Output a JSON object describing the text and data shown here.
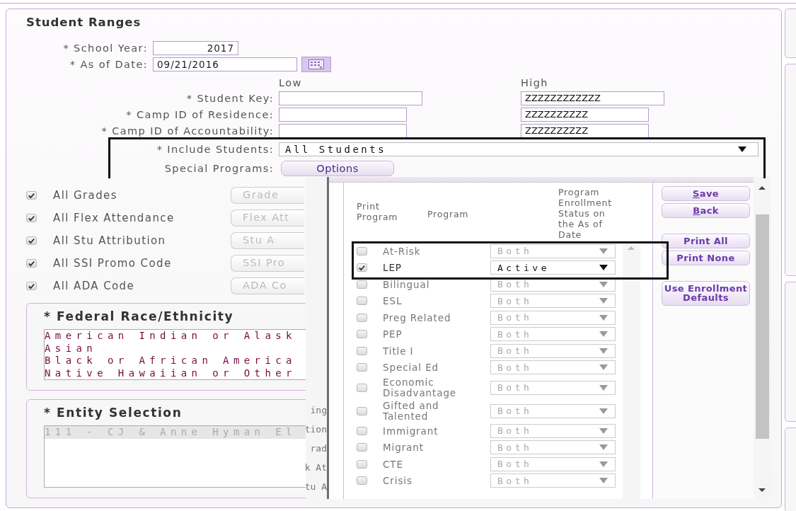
{
  "form": {
    "title": "Student Ranges",
    "school_year": {
      "label": "* School Year:",
      "value": "2017"
    },
    "as_of_date": {
      "label": "* As of Date:",
      "value": "09/21/2016"
    },
    "range_headers": {
      "low": "Low",
      "high": "High"
    },
    "ranges": [
      {
        "label": "* Student Key:",
        "high": "ZZZZZZZZZZZZ"
      },
      {
        "label": "* Camp ID of Residence:",
        "high": "ZZZZZZZZZZ"
      },
      {
        "label": "* Camp ID of Accountability:",
        "high": "ZZZZZZZZZZ"
      }
    ],
    "include_students": {
      "label": "* Include Students:",
      "value": "All Students"
    },
    "special_programs": {
      "label": "Special Programs:",
      "button": "Options"
    },
    "filters": [
      {
        "label": "All Grades",
        "checked": true,
        "button": "Grade",
        "disabled": true
      },
      {
        "label": "All Flex Attendance",
        "checked": true,
        "button": "Flex Att",
        "disabled": true
      },
      {
        "label": "All Stu Attribution",
        "checked": true,
        "button": "Stu A",
        "disabled": true
      },
      {
        "label": "All SSI Promo Code",
        "checked": true,
        "button": "SSI Pro",
        "disabled": true
      },
      {
        "label": "All ADA Code",
        "checked": true,
        "button": "ADA Co",
        "disabled": true
      }
    ],
    "race": {
      "title": "* Federal Race/Ethnicity",
      "options": [
        "American Indian or Alask",
        "Asian",
        "Black or African America",
        "Native Hawaiian or Other"
      ]
    },
    "entity": {
      "title": "* Entity Selection",
      "options": [
        {
          "label": "111 - CJ & Anne Hyman El",
          "selected": true
        }
      ]
    },
    "background_fragments": [
      "ing",
      "tion",
      "rad",
      "k At",
      "tu A"
    ]
  },
  "dialog": {
    "columns": [
      "Print Program",
      "Program",
      "Program Enrollment Status on the As of Date"
    ],
    "programs": [
      {
        "name": "At-Risk",
        "checked": false,
        "status": "Both"
      },
      {
        "name": "LEP",
        "checked": true,
        "status": "Active"
      },
      {
        "name": "Bilingual",
        "checked": false,
        "status": "Both"
      },
      {
        "name": "ESL",
        "checked": false,
        "status": "Both"
      },
      {
        "name": "Preg Related",
        "checked": false,
        "status": "Both"
      },
      {
        "name": "PEP",
        "checked": false,
        "status": "Both"
      },
      {
        "name": "Title I",
        "checked": false,
        "status": "Both"
      },
      {
        "name": "Special Ed",
        "checked": false,
        "status": "Both"
      },
      {
        "name": "Economic Disadvantage",
        "checked": false,
        "status": "Both"
      },
      {
        "name": "Gifted and Talented",
        "checked": false,
        "status": "Both"
      },
      {
        "name": "Immigrant",
        "checked": false,
        "status": "Both"
      },
      {
        "name": "Migrant",
        "checked": false,
        "status": "Both"
      },
      {
        "name": "CTE",
        "checked": false,
        "status": "Both"
      },
      {
        "name": "Crisis",
        "checked": false,
        "status": "Both"
      }
    ],
    "button_groups": [
      [
        {
          "label": "Save",
          "mnemonic": true
        },
        {
          "label": "Back",
          "mnemonic": true
        }
      ],
      [
        {
          "label": "Print All",
          "mnemonic": false
        },
        {
          "label": "Print None",
          "mnemonic": false
        }
      ],
      [
        {
          "label": "Use Enrollment Defaults",
          "mnemonic": false
        }
      ]
    ]
  }
}
